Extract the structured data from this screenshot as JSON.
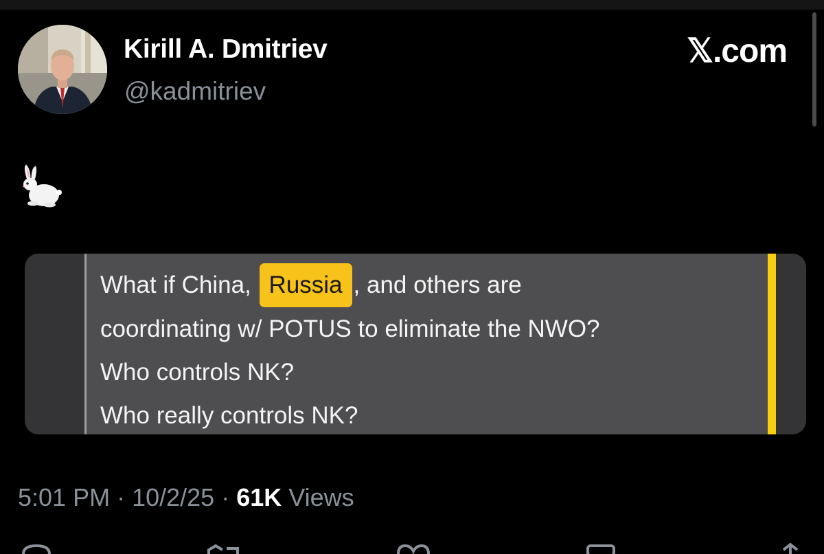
{
  "post": {
    "author_name": "Kirill A. Dmitriev",
    "author_handle": "@kadmitriev",
    "site_logo": "𝕏.com",
    "emoji_text": "rabbit emoji",
    "embed": {
      "line1_before": "What if China, ",
      "line1_highlight": "Russia",
      "line1_after": ", and others are",
      "line2": "coordinating w/ POTUS to eliminate the NWO?",
      "line3": "Who controls NK?",
      "line4": "Who really controls NK?",
      "highlight_color": "#f7c21a",
      "bar_color": "#f7cf12"
    },
    "time": "5:01 PM",
    "date": "10/2/25",
    "views_count": "61K",
    "views_label": "Views"
  },
  "icons": {
    "avatar": "author-avatar-photo",
    "rabbit": "rabbit-emoji",
    "actions": [
      "reply-icon",
      "repost-icon",
      "like-icon",
      "bookmark-icon",
      "share-icon"
    ]
  }
}
